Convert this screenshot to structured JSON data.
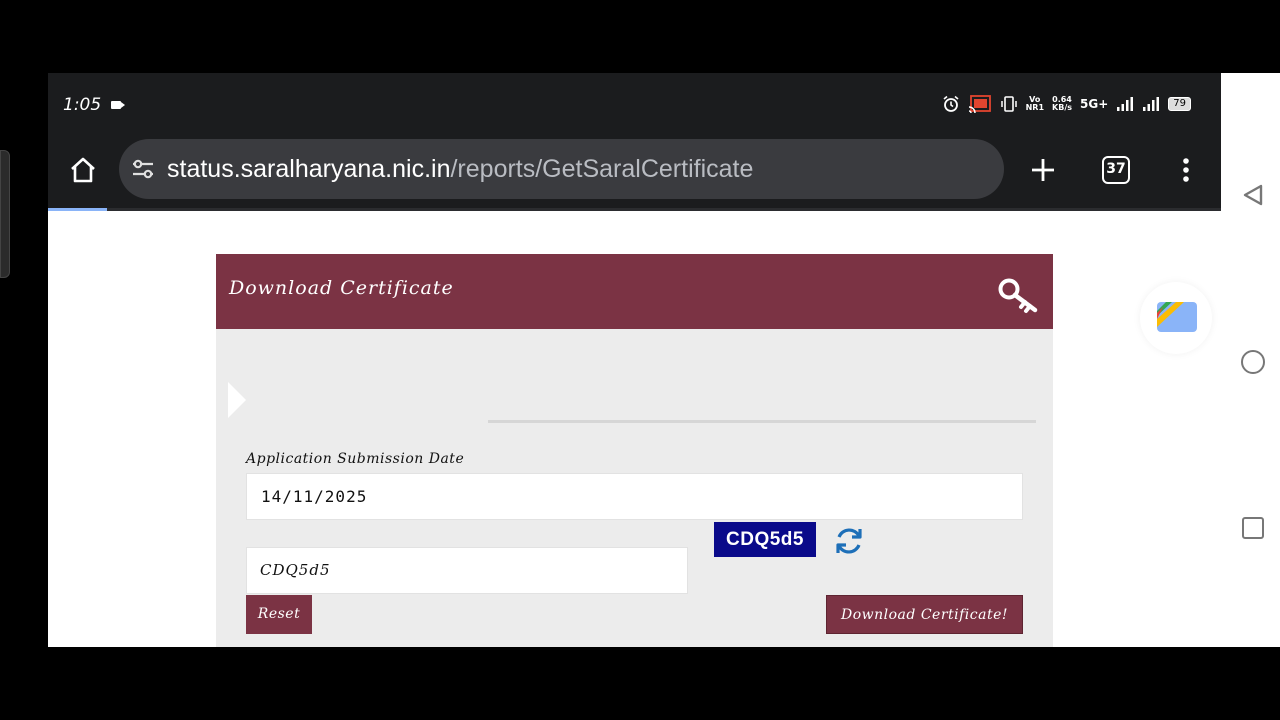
{
  "status_bar": {
    "time": "1:05",
    "net_speed_value": "0.64",
    "net_speed_unit": "KB/s",
    "network": "5G+",
    "vo_top": "Vo",
    "vo_bottom": "NR1",
    "battery": "79"
  },
  "browser": {
    "url_host": "status.saralharyana.nic.in",
    "url_path": "/reports/GetSaralCertificate",
    "tab_count": "37",
    "load_progress": 0.05
  },
  "page": {
    "panel_title": "Download Certificate",
    "date_label": "Application Submission Date",
    "date_value": "14/11/2025",
    "captcha_text": "CDQ5d5",
    "captcha_input_value": "CDQ5d5",
    "reset_label": "Reset",
    "download_label": "Download Certificate!",
    "header_color": "#7b3344",
    "captcha_bg_color": "#0a0a8a"
  },
  "icons": {
    "home": "home-icon",
    "site_settings": "tune-icon",
    "new_tab": "plus-icon",
    "more": "more-vert-icon",
    "key": "key-icon",
    "refresh": "refresh-icon",
    "nav_back": "back-icon",
    "nav_home": "circle-home-icon",
    "nav_recent": "square-recents-icon"
  }
}
